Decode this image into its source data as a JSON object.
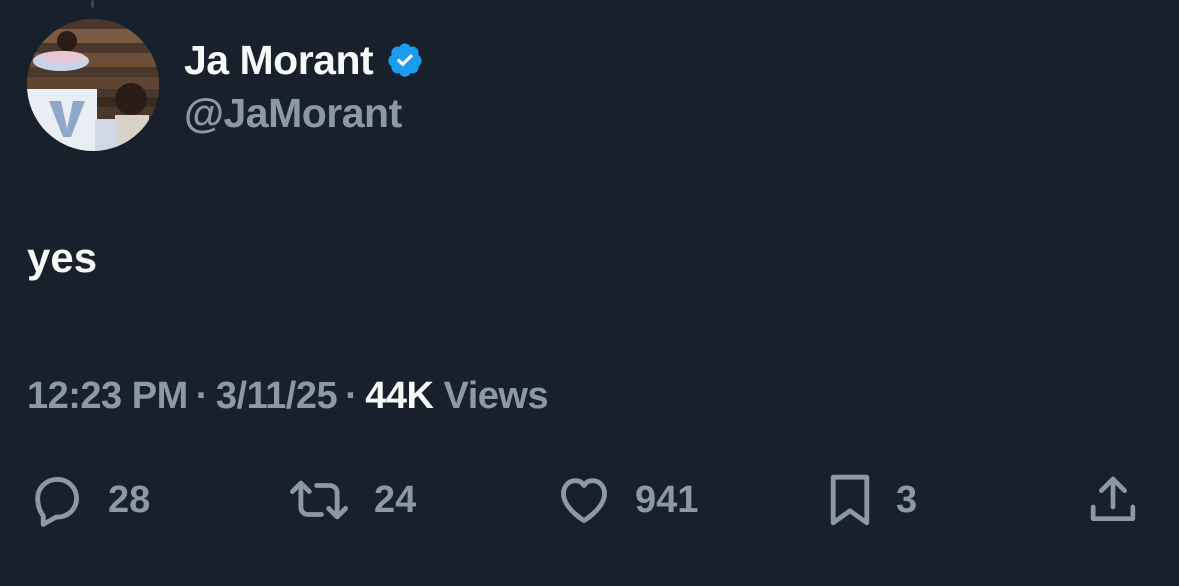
{
  "author": {
    "display_name": "Ja Morant",
    "handle": "@JaMorant",
    "verified": true
  },
  "tweet": {
    "text": "yes",
    "time": "12:23 PM",
    "separator": "·",
    "date": "3/11/25",
    "views_count": "44K",
    "views_label": "Views"
  },
  "actions": {
    "replies": "28",
    "reposts": "24",
    "likes": "941",
    "bookmarks": "3"
  },
  "icons": {
    "reply": "reply-icon",
    "repost": "repost-icon",
    "like": "heart-icon",
    "bookmark": "bookmark-icon",
    "share": "share-icon",
    "verified": "verified-badge-icon"
  },
  "colors": {
    "background": "#17202b",
    "primary_text": "#f7f9f9",
    "secondary_text": "#8b98a5",
    "verified_blue": "#1d9bf0"
  }
}
